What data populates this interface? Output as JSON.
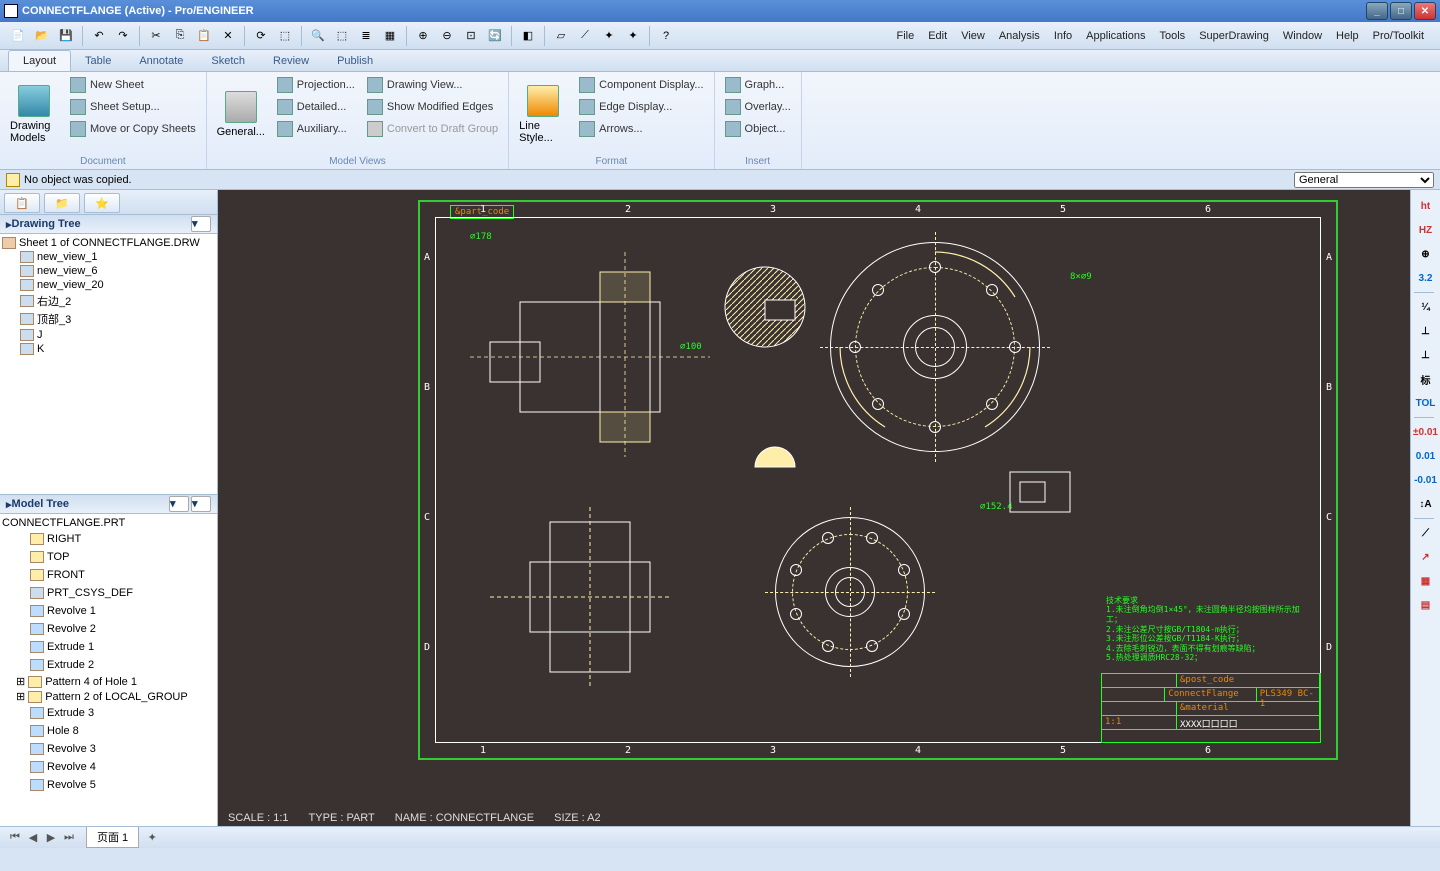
{
  "titlebar": {
    "text": "CONNECTFLANGE (Active) - Pro/ENGINEER"
  },
  "menubar": [
    "File",
    "Edit",
    "View",
    "Analysis",
    "Info",
    "Applications",
    "Tools",
    "SuperDrawing",
    "Window",
    "Help",
    "Pro/Toolkit"
  ],
  "tabs": [
    "Layout",
    "Table",
    "Annotate",
    "Sketch",
    "Review",
    "Publish"
  ],
  "active_tab": "Layout",
  "ribbon": {
    "document": {
      "title": "Document",
      "big": "Drawing Models",
      "items": [
        "New Sheet",
        "Sheet Setup...",
        "Move or Copy Sheets"
      ]
    },
    "modelviews": {
      "title": "Model Views",
      "big": "General...",
      "col1": [
        "Projection...",
        "Detailed...",
        "Auxiliary..."
      ],
      "col2": [
        "Drawing View...",
        "Show Modified Edges",
        "Convert to Draft Group"
      ]
    },
    "format": {
      "title": "Format",
      "big": "Line Style...",
      "items": [
        "Component Display...",
        "Edge Display...",
        "Arrows..."
      ]
    },
    "insert": {
      "title": "Insert",
      "items": [
        "Graph...",
        "Overlay...",
        "Object..."
      ]
    }
  },
  "message": "No object was copied.",
  "filter_dropdown": "General",
  "drawing_tree": {
    "title": "Drawing Tree",
    "root": "Sheet 1 of CONNECTFLANGE.DRW",
    "items": [
      "new_view_1",
      "new_view_6",
      "new_view_20",
      "右边_2",
      "顶部_3",
      "J",
      "K"
    ]
  },
  "model_tree": {
    "title": "Model Tree",
    "root": "CONNECTFLANGE.PRT",
    "items": [
      {
        "n": "RIGHT",
        "t": "d"
      },
      {
        "n": "TOP",
        "t": "d"
      },
      {
        "n": "FRONT",
        "t": "d"
      },
      {
        "n": "PRT_CSYS_DEF",
        "t": "c"
      },
      {
        "n": "Revolve 1",
        "t": "r"
      },
      {
        "n": "Revolve 2",
        "t": "r"
      },
      {
        "n": "Extrude 1",
        "t": "e"
      },
      {
        "n": "Extrude 2",
        "t": "e"
      },
      {
        "n": "Pattern 4 of Hole 1",
        "t": "p"
      },
      {
        "n": "Pattern 2 of LOCAL_GROUP",
        "t": "p"
      },
      {
        "n": "Extrude 3",
        "t": "e"
      },
      {
        "n": "Hole 8",
        "t": "h"
      },
      {
        "n": "Revolve 3",
        "t": "r"
      },
      {
        "n": "Revolve 4",
        "t": "r"
      },
      {
        "n": "Revolve 5",
        "t": "r"
      }
    ]
  },
  "canvas": {
    "status": [
      "SCALE : 1:1",
      "TYPE : PART",
      "NAME : CONNECTFLANGE",
      "SIZE : A2"
    ],
    "zones_top": [
      "1",
      "2",
      "3",
      "4",
      "5",
      "6"
    ],
    "zones_side": [
      "A",
      "B",
      "C",
      "D"
    ],
    "titleblock": {
      "name": "ConnectFlange",
      "code": "&post_code",
      "mat": "&material",
      "scale": "1:1",
      "id": "PLS349 BC-1",
      "boxes": "XXXX口口口口"
    },
    "partcode": "&part_code",
    "notes": "技术要求\n1.未注倒角均倒1×45°，未注圆角半径均按图样所示加工；\n2.未注公差尺寸按GB/T1804-m执行；\n3.未注形位公差按GB/T1184-K执行；\n4.去除毛刺锐边，表面不得有划痕等缺陷；\n5.热处理调质HRC28-32；"
  },
  "sheet_tab": "页面 1",
  "right_tools": [
    "ht",
    "HZ",
    "⊕",
    "3.2",
    "¼",
    "⊥",
    "⊥",
    "标",
    "TOL",
    "±0.01",
    "0.01",
    "-0.01",
    "↕A",
    "⟋",
    "↗",
    "▦",
    "▤"
  ]
}
